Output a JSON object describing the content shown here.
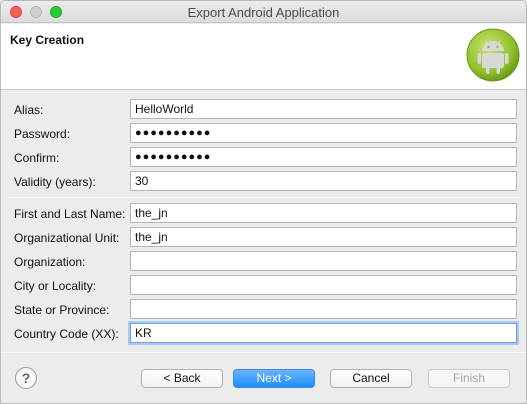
{
  "window": {
    "title": "Export Android Application"
  },
  "header": {
    "title": "Key Creation"
  },
  "form": {
    "alias": {
      "label": "Alias:",
      "value": "HelloWorld"
    },
    "password": {
      "label": "Password:",
      "value": "●●●●●●●●●●"
    },
    "confirm": {
      "label": "Confirm:",
      "value": "●●●●●●●●●●"
    },
    "validity": {
      "label": "Validity (years):",
      "value": "30"
    },
    "name": {
      "label": "First and Last Name:",
      "value": "the_jn"
    },
    "unit": {
      "label": "Organizational Unit:",
      "value": "the_jn"
    },
    "organization": {
      "label": "Organization:",
      "value": ""
    },
    "city": {
      "label": "City or Locality:",
      "value": ""
    },
    "state": {
      "label": "State or Province:",
      "value": ""
    },
    "country": {
      "label": "Country Code (XX):",
      "value": "KR"
    }
  },
  "footer": {
    "help": "?",
    "back": "< Back",
    "next": "Next >",
    "cancel": "Cancel",
    "finish": "Finish"
  },
  "icons": {
    "logo": "android-robot-icon",
    "help": "help-icon"
  },
  "colors": {
    "accent": "#1d8dfc",
    "android_green": "#a4c639"
  }
}
